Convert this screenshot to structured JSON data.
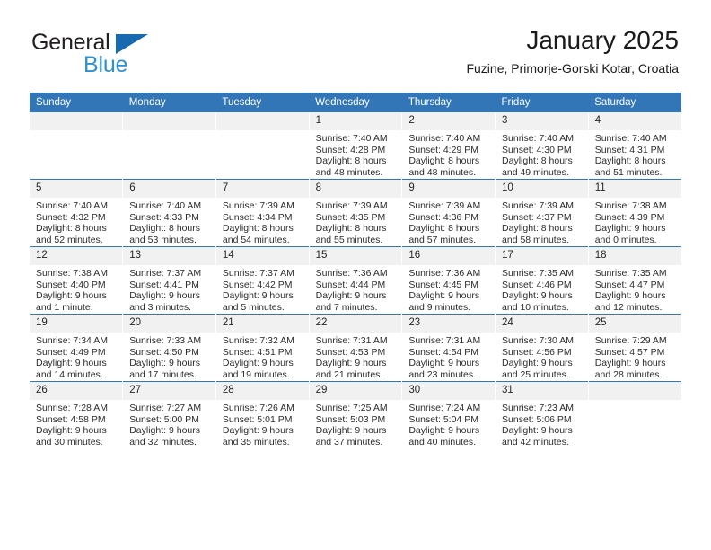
{
  "brand": {
    "name_top": "General",
    "name_bottom": "Blue",
    "accent_color": "#2c90d4",
    "triangle_color": "#1769b0"
  },
  "header": {
    "month_title": "January 2025",
    "location": "Fuzine, Primorje-Gorski Kotar, Croatia"
  },
  "calendar": {
    "header_bg": "#3276b8",
    "daynum_bg": "#f1f1f1",
    "weekday_headers": [
      "Sunday",
      "Monday",
      "Tuesday",
      "Wednesday",
      "Thursday",
      "Friday",
      "Saturday"
    ],
    "weeks": [
      [
        {
          "day": "",
          "empty": true
        },
        {
          "day": "",
          "empty": true
        },
        {
          "day": "",
          "empty": true
        },
        {
          "day": "1",
          "sunrise": "Sunrise: 7:40 AM",
          "sunset": "Sunset: 4:28 PM",
          "daylight_line1": "Daylight: 8 hours",
          "daylight_line2": "and 48 minutes."
        },
        {
          "day": "2",
          "sunrise": "Sunrise: 7:40 AM",
          "sunset": "Sunset: 4:29 PM",
          "daylight_line1": "Daylight: 8 hours",
          "daylight_line2": "and 48 minutes."
        },
        {
          "day": "3",
          "sunrise": "Sunrise: 7:40 AM",
          "sunset": "Sunset: 4:30 PM",
          "daylight_line1": "Daylight: 8 hours",
          "daylight_line2": "and 49 minutes."
        },
        {
          "day": "4",
          "sunrise": "Sunrise: 7:40 AM",
          "sunset": "Sunset: 4:31 PM",
          "daylight_line1": "Daylight: 8 hours",
          "daylight_line2": "and 51 minutes."
        }
      ],
      [
        {
          "day": "5",
          "sunrise": "Sunrise: 7:40 AM",
          "sunset": "Sunset: 4:32 PM",
          "daylight_line1": "Daylight: 8 hours",
          "daylight_line2": "and 52 minutes."
        },
        {
          "day": "6",
          "sunrise": "Sunrise: 7:40 AM",
          "sunset": "Sunset: 4:33 PM",
          "daylight_line1": "Daylight: 8 hours",
          "daylight_line2": "and 53 minutes."
        },
        {
          "day": "7",
          "sunrise": "Sunrise: 7:39 AM",
          "sunset": "Sunset: 4:34 PM",
          "daylight_line1": "Daylight: 8 hours",
          "daylight_line2": "and 54 minutes."
        },
        {
          "day": "8",
          "sunrise": "Sunrise: 7:39 AM",
          "sunset": "Sunset: 4:35 PM",
          "daylight_line1": "Daylight: 8 hours",
          "daylight_line2": "and 55 minutes."
        },
        {
          "day": "9",
          "sunrise": "Sunrise: 7:39 AM",
          "sunset": "Sunset: 4:36 PM",
          "daylight_line1": "Daylight: 8 hours",
          "daylight_line2": "and 57 minutes."
        },
        {
          "day": "10",
          "sunrise": "Sunrise: 7:39 AM",
          "sunset": "Sunset: 4:37 PM",
          "daylight_line1": "Daylight: 8 hours",
          "daylight_line2": "and 58 minutes."
        },
        {
          "day": "11",
          "sunrise": "Sunrise: 7:38 AM",
          "sunset": "Sunset: 4:39 PM",
          "daylight_line1": "Daylight: 9 hours",
          "daylight_line2": "and 0 minutes."
        }
      ],
      [
        {
          "day": "12",
          "sunrise": "Sunrise: 7:38 AM",
          "sunset": "Sunset: 4:40 PM",
          "daylight_line1": "Daylight: 9 hours",
          "daylight_line2": "and 1 minute."
        },
        {
          "day": "13",
          "sunrise": "Sunrise: 7:37 AM",
          "sunset": "Sunset: 4:41 PM",
          "daylight_line1": "Daylight: 9 hours",
          "daylight_line2": "and 3 minutes."
        },
        {
          "day": "14",
          "sunrise": "Sunrise: 7:37 AM",
          "sunset": "Sunset: 4:42 PM",
          "daylight_line1": "Daylight: 9 hours",
          "daylight_line2": "and 5 minutes."
        },
        {
          "day": "15",
          "sunrise": "Sunrise: 7:36 AM",
          "sunset": "Sunset: 4:44 PM",
          "daylight_line1": "Daylight: 9 hours",
          "daylight_line2": "and 7 minutes."
        },
        {
          "day": "16",
          "sunrise": "Sunrise: 7:36 AM",
          "sunset": "Sunset: 4:45 PM",
          "daylight_line1": "Daylight: 9 hours",
          "daylight_line2": "and 9 minutes."
        },
        {
          "day": "17",
          "sunrise": "Sunrise: 7:35 AM",
          "sunset": "Sunset: 4:46 PM",
          "daylight_line1": "Daylight: 9 hours",
          "daylight_line2": "and 10 minutes."
        },
        {
          "day": "18",
          "sunrise": "Sunrise: 7:35 AM",
          "sunset": "Sunset: 4:47 PM",
          "daylight_line1": "Daylight: 9 hours",
          "daylight_line2": "and 12 minutes."
        }
      ],
      [
        {
          "day": "19",
          "sunrise": "Sunrise: 7:34 AM",
          "sunset": "Sunset: 4:49 PM",
          "daylight_line1": "Daylight: 9 hours",
          "daylight_line2": "and 14 minutes."
        },
        {
          "day": "20",
          "sunrise": "Sunrise: 7:33 AM",
          "sunset": "Sunset: 4:50 PM",
          "daylight_line1": "Daylight: 9 hours",
          "daylight_line2": "and 17 minutes."
        },
        {
          "day": "21",
          "sunrise": "Sunrise: 7:32 AM",
          "sunset": "Sunset: 4:51 PM",
          "daylight_line1": "Daylight: 9 hours",
          "daylight_line2": "and 19 minutes."
        },
        {
          "day": "22",
          "sunrise": "Sunrise: 7:31 AM",
          "sunset": "Sunset: 4:53 PM",
          "daylight_line1": "Daylight: 9 hours",
          "daylight_line2": "and 21 minutes."
        },
        {
          "day": "23",
          "sunrise": "Sunrise: 7:31 AM",
          "sunset": "Sunset: 4:54 PM",
          "daylight_line1": "Daylight: 9 hours",
          "daylight_line2": "and 23 minutes."
        },
        {
          "day": "24",
          "sunrise": "Sunrise: 7:30 AM",
          "sunset": "Sunset: 4:56 PM",
          "daylight_line1": "Daylight: 9 hours",
          "daylight_line2": "and 25 minutes."
        },
        {
          "day": "25",
          "sunrise": "Sunrise: 7:29 AM",
          "sunset": "Sunset: 4:57 PM",
          "daylight_line1": "Daylight: 9 hours",
          "daylight_line2": "and 28 minutes."
        }
      ],
      [
        {
          "day": "26",
          "sunrise": "Sunrise: 7:28 AM",
          "sunset": "Sunset: 4:58 PM",
          "daylight_line1": "Daylight: 9 hours",
          "daylight_line2": "and 30 minutes."
        },
        {
          "day": "27",
          "sunrise": "Sunrise: 7:27 AM",
          "sunset": "Sunset: 5:00 PM",
          "daylight_line1": "Daylight: 9 hours",
          "daylight_line2": "and 32 minutes."
        },
        {
          "day": "28",
          "sunrise": "Sunrise: 7:26 AM",
          "sunset": "Sunset: 5:01 PM",
          "daylight_line1": "Daylight: 9 hours",
          "daylight_line2": "and 35 minutes."
        },
        {
          "day": "29",
          "sunrise": "Sunrise: 7:25 AM",
          "sunset": "Sunset: 5:03 PM",
          "daylight_line1": "Daylight: 9 hours",
          "daylight_line2": "and 37 minutes."
        },
        {
          "day": "30",
          "sunrise": "Sunrise: 7:24 AM",
          "sunset": "Sunset: 5:04 PM",
          "daylight_line1": "Daylight: 9 hours",
          "daylight_line2": "and 40 minutes."
        },
        {
          "day": "31",
          "sunrise": "Sunrise: 7:23 AM",
          "sunset": "Sunset: 5:06 PM",
          "daylight_line1": "Daylight: 9 hours",
          "daylight_line2": "and 42 minutes."
        },
        {
          "day": "",
          "empty": true
        }
      ]
    ]
  }
}
